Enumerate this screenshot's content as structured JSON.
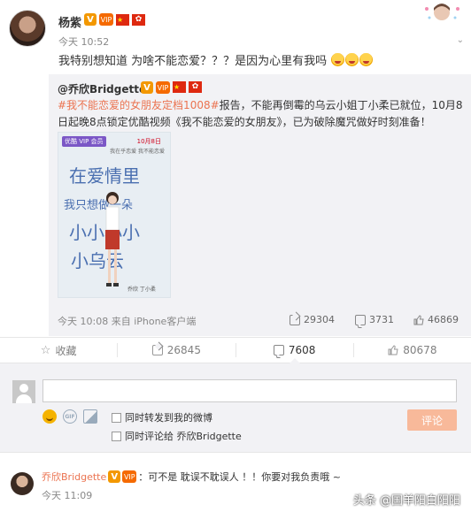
{
  "post": {
    "author": "杨紫",
    "time": "今天 10:52",
    "text": "我特别想知道 为啥不能恋爱？？？是因为心里有我吗",
    "badges": {
      "v": "V",
      "vip": "VIP",
      "flag": "★",
      "flag2": "✿"
    }
  },
  "repost": {
    "author": "@乔欣Bridgette",
    "hashtag": "#我不能恋爱的女朋友定档1008#",
    "text_rest": "报告，不能再倒霉的乌云小姐丁小柔已就位，10月8日起晚8点锁定优酷视频《我不能恋爱的女朋友》，已为破除魔咒做好时刻准备！",
    "poster": {
      "vip_label": "优酷 VIP 会员",
      "date": "10月8日",
      "sub": "我在乎恋爱 我不能恋爱",
      "title_lines": [
        "在爱情里",
        "我只想做一朵",
        "小小小小",
        "小乌云"
      ],
      "names": "乔欣 丁小柔"
    },
    "meta": "今天 10:08 来自 iPhone客户端",
    "stats": {
      "shares": "29304",
      "comments": "3731",
      "likes": "46869"
    }
  },
  "actions": {
    "favorite": "收藏",
    "share": "26845",
    "comment": "7608",
    "like": "80678"
  },
  "composer": {
    "placeholder": "",
    "repost_label": "同时转发到我的微博",
    "comment_label": "同时评论给 乔欣Bridgette",
    "submit": "评论"
  },
  "comment": {
    "author": "乔欣Bridgette",
    "text": "：可不是 耽误不耽误人 ！！你要对我负责哦 ~",
    "time": "今天 11:09",
    "watermark": "头条 @国羊阳白阳阳"
  },
  "colors": {
    "accent": "#eb7350",
    "submit": "#f8b99a",
    "verified": "#f39800"
  }
}
